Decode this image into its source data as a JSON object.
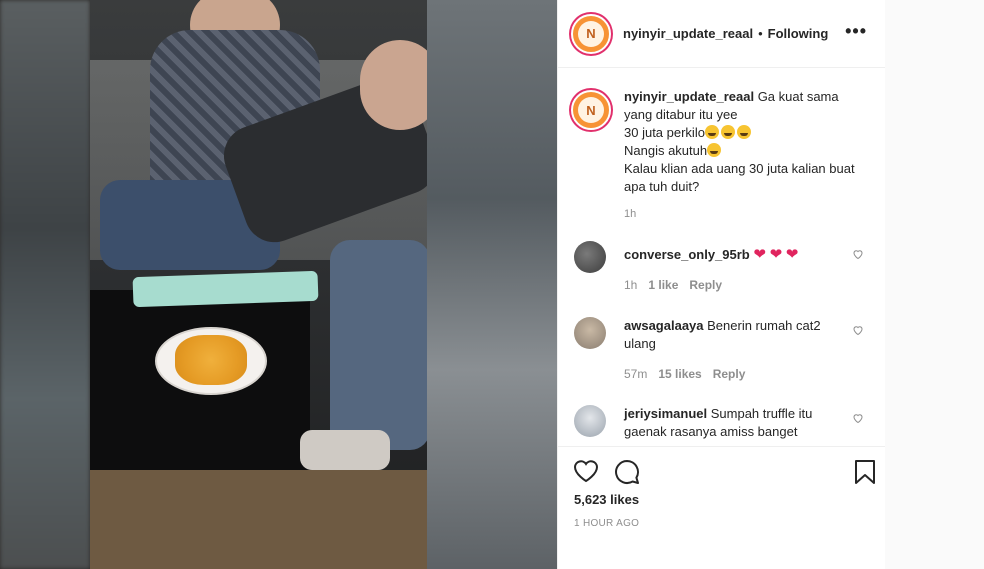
{
  "post": {
    "username": "nyinyir_update_reaal",
    "separator": "•",
    "follow_status": "Following",
    "more_label": "•••",
    "avatar_initial": "N"
  },
  "caption": {
    "username": "nyinyir_update_reaal",
    "lines": [
      "Ga kuat sama yang ditabur itu yee",
      "30 juta perkilo",
      "Nangis akutuh",
      "Kalau klian ada uang 30 juta kalian buat apa tuh duit?"
    ],
    "time": "1h"
  },
  "comments": [
    {
      "username": "converse_only_95rb",
      "text": "",
      "time": "1h",
      "likes": "1 like",
      "reply": "Reply"
    },
    {
      "username": "awsagalaaya",
      "text": "Benerin rumah cat2 ulang",
      "time": "57m",
      "likes": "15 likes",
      "reply": "Reply"
    },
    {
      "username": "jeriysimanuel",
      "text": "Sumpah truffle itu gaenak rasanya amiss banget",
      "time": "",
      "likes": "",
      "reply": ""
    }
  ],
  "footer": {
    "likes": "5,623 likes",
    "posted": "1 HOUR AGO"
  },
  "colors": {
    "accent": "#e1306c",
    "avatar": "#f79335",
    "muted": "#8e8e8e",
    "heart": "#e0245e"
  }
}
